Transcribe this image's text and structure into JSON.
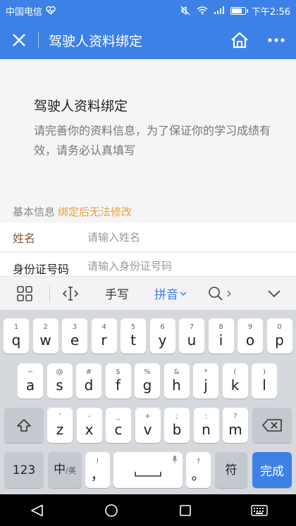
{
  "status": {
    "carrier": "中国电信",
    "time": "下午2:56",
    "battery_level": 0.85
  },
  "nav": {
    "title": "驾驶人资料绑定"
  },
  "content": {
    "title": "驾驶人资料绑定",
    "description": "请完善你的资料信息，为了保证你的学习成绩有效，请务必认真填写",
    "section_label": "基本信息",
    "section_warning": "绑定后无法修改",
    "fields": [
      {
        "label": "姓名",
        "placeholder": "请输入姓名"
      },
      {
        "label": "身份证号码",
        "placeholder": "请输入身份证号码"
      }
    ]
  },
  "keyboard": {
    "toolbar": {
      "handwriting": "手写",
      "pinyin": "拼音"
    },
    "row1": [
      {
        "main": "q",
        "sub": "1"
      },
      {
        "main": "w",
        "sub": "2"
      },
      {
        "main": "e",
        "sub": "3"
      },
      {
        "main": "r",
        "sub": "4"
      },
      {
        "main": "t",
        "sub": "5"
      },
      {
        "main": "y",
        "sub": "6"
      },
      {
        "main": "u",
        "sub": "7"
      },
      {
        "main": "i",
        "sub": "8"
      },
      {
        "main": "o",
        "sub": "9"
      },
      {
        "main": "p",
        "sub": "0"
      }
    ],
    "row2": [
      {
        "main": "a",
        "sub": "~"
      },
      {
        "main": "s",
        "sub": "@"
      },
      {
        "main": "d",
        "sub": "#"
      },
      {
        "main": "f",
        "sub": "$"
      },
      {
        "main": "g",
        "sub": "%"
      },
      {
        "main": "h",
        "sub": "&"
      },
      {
        "main": "j",
        "sub": "*"
      },
      {
        "main": "k",
        "sub": "("
      },
      {
        "main": "l",
        "sub": ")"
      }
    ],
    "row3": [
      {
        "main": "z",
        "sub": "'"
      },
      {
        "main": "x",
        "sub": "-"
      },
      {
        "main": "c",
        "sub": "_"
      },
      {
        "main": "v",
        "sub": "+"
      },
      {
        "main": "b",
        "sub": ";"
      },
      {
        "main": "n",
        "sub": ":"
      },
      {
        "main": "m",
        "sub": "?"
      }
    ],
    "numbers": "123",
    "zh": "中",
    "en": "/英",
    "comma": "，",
    "comma_sub": "!",
    "period": "。",
    "period_sub": "?",
    "symbol": "符",
    "done": "完成"
  },
  "colors": {
    "accent": "#3d81e6",
    "warning": "#e6a23c"
  }
}
